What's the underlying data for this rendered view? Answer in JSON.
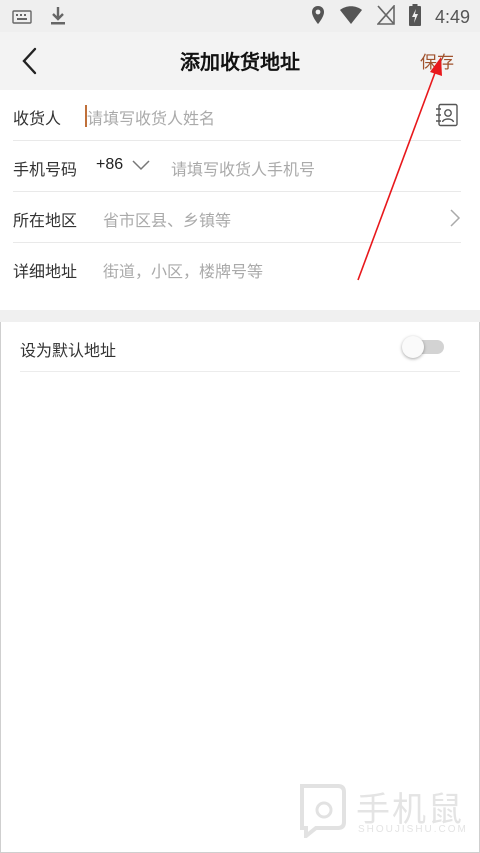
{
  "status_bar": {
    "time": "4:49",
    "icons": [
      "keyboard-icon",
      "download-icon",
      "location-icon",
      "wifi-icon",
      "no-sim-icon",
      "battery-charging-icon"
    ]
  },
  "header": {
    "title": "添加收货地址",
    "save_label": "保存"
  },
  "form": {
    "recipient": {
      "label": "收货人",
      "placeholder": "请填写收货人姓名"
    },
    "phone": {
      "label": "手机号码",
      "country_code": "+86",
      "placeholder": "请填写收货人手机号"
    },
    "region": {
      "label": "所在地区",
      "placeholder": "省市区县、乡镇等"
    },
    "address": {
      "label": "详细地址",
      "placeholder": "街道，小区，楼牌号等"
    }
  },
  "default_address": {
    "label": "设为默认地址",
    "enabled": false
  },
  "colors": {
    "accent": "#a0522d",
    "annotation": "#e8181c",
    "header_bg": "#f3f3f3"
  },
  "watermark": {
    "title": "手机鼠",
    "subtitle": "SHOUJISHU.COM"
  }
}
